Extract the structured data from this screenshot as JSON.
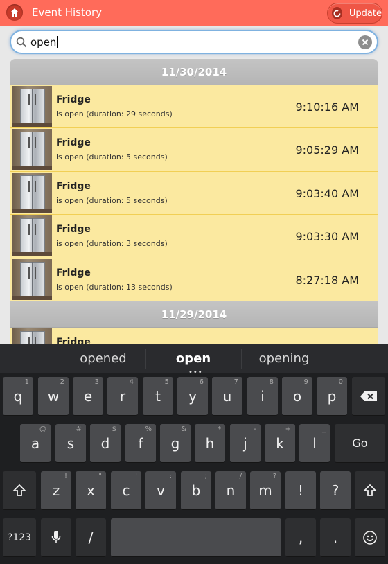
{
  "header": {
    "title": "Event History",
    "update_label": "Update"
  },
  "search": {
    "value": "open"
  },
  "groups": [
    {
      "date": "11/30/2014",
      "events": [
        {
          "name": "Fridge",
          "desc": "is open (duration: 29 seconds)",
          "time": "9:10:16 AM"
        },
        {
          "name": "Fridge",
          "desc": "is open (duration: 5 seconds)",
          "time": "9:05:29 AM"
        },
        {
          "name": "Fridge",
          "desc": "is open (duration: 5 seconds)",
          "time": "9:03:40 AM"
        },
        {
          "name": "Fridge",
          "desc": "is open (duration: 3 seconds)",
          "time": "9:03:30 AM"
        },
        {
          "name": "Fridge",
          "desc": "is open (duration: 13 seconds)",
          "time": "8:27:18 AM"
        }
      ]
    },
    {
      "date": "11/29/2014",
      "events": [
        {
          "name": "Fridge",
          "desc": "",
          "time": ""
        }
      ]
    }
  ],
  "keyboard": {
    "suggestions": [
      "opened",
      "open",
      "opening"
    ],
    "row1": [
      {
        "k": "q",
        "h": "1"
      },
      {
        "k": "w",
        "h": "2"
      },
      {
        "k": "e",
        "h": "3"
      },
      {
        "k": "r",
        "h": "4"
      },
      {
        "k": "t",
        "h": "5"
      },
      {
        "k": "y",
        "h": "6"
      },
      {
        "k": "u",
        "h": "7"
      },
      {
        "k": "i",
        "h": "8"
      },
      {
        "k": "o",
        "h": "9"
      },
      {
        "k": "p",
        "h": "0"
      }
    ],
    "row2": [
      {
        "k": "a",
        "h": "@"
      },
      {
        "k": "s",
        "h": "#"
      },
      {
        "k": "d",
        "h": "$"
      },
      {
        "k": "f",
        "h": "%"
      },
      {
        "k": "g",
        "h": "&"
      },
      {
        "k": "h",
        "h": "*"
      },
      {
        "k": "j",
        "h": "-"
      },
      {
        "k": "k",
        "h": "+"
      },
      {
        "k": "l",
        "h": "_"
      }
    ],
    "row3": [
      {
        "k": "z",
        "h": "!"
      },
      {
        "k": "x",
        "h": "\""
      },
      {
        "k": "c",
        "h": "'"
      },
      {
        "k": "v",
        "h": ":"
      },
      {
        "k": "b",
        "h": ";"
      },
      {
        "k": "n",
        "h": "/"
      },
      {
        "k": "m",
        "h": "?"
      },
      {
        "k": "!",
        "h": ""
      },
      {
        "k": "?",
        "h": ""
      }
    ],
    "go_label": "Go",
    "symbols_label": "?123",
    "slash_label": "/",
    "comma_label": ",",
    "period_label": "."
  },
  "colors": {
    "header": "#ff6b5a",
    "row": "#fbe9a0",
    "divider": "#b9b9b9"
  }
}
